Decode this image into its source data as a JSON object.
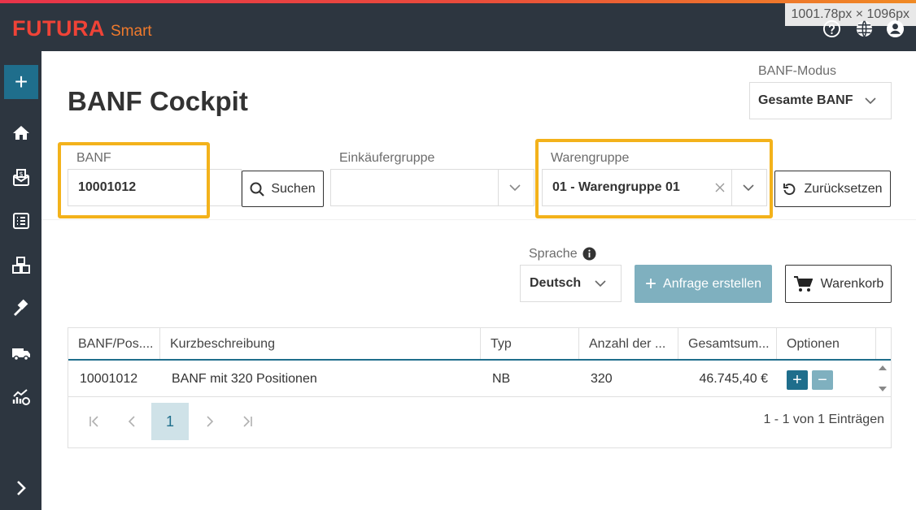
{
  "app": {
    "brand": "FUTURA",
    "brand_sub": "Smart",
    "dimension_badge": "1001.78px × 1096px"
  },
  "top_icons": [
    "help-icon",
    "globe-icon",
    "user-avatar-icon"
  ],
  "sidebar": {
    "items": [
      "add-icon",
      "home-icon",
      "banf-money-icon",
      "checklist-icon",
      "boxes-icon",
      "auction-hammer-icon",
      "truck-icon",
      "analytics-icon",
      "expand-chevron-icon"
    ]
  },
  "page": {
    "title": "BANF Cockpit"
  },
  "mode": {
    "label": "BANF-Modus",
    "value": "Gesamte BANF"
  },
  "filters": {
    "banf_label": "BANF",
    "banf_value": "10001012",
    "search_label": "Suchen",
    "buyer_label": "Einkäufergruppe",
    "buyer_value": "",
    "group_label": "Warengruppe",
    "group_value": "01 - Warengruppe 01",
    "reset_label": "Zurücksetzen"
  },
  "language": {
    "label": "Sprache",
    "value": "Deutsch"
  },
  "actions": {
    "create_request": "Anfrage erstellen",
    "cart": "Warenkorb"
  },
  "table": {
    "headers": [
      "BANF/Pos....",
      "Kurzbeschreibung",
      "Typ",
      "Anzahl der ...",
      "Gesamtsum...",
      "Optionen"
    ],
    "rows": [
      {
        "banf": "10001012",
        "desc": "BANF mit 320 Positionen",
        "typ": "NB",
        "count": "320",
        "total": "46.745,40 €"
      }
    ],
    "pager": {
      "current_page": "1",
      "summary": "1 - 1 von 1 Einträgen"
    }
  },
  "colors": {
    "accent_teal": "#1f6e8c",
    "highlight": "#f3b21b",
    "disabled_button": "#7fb0bf",
    "dark_bar": "#2d3640"
  }
}
